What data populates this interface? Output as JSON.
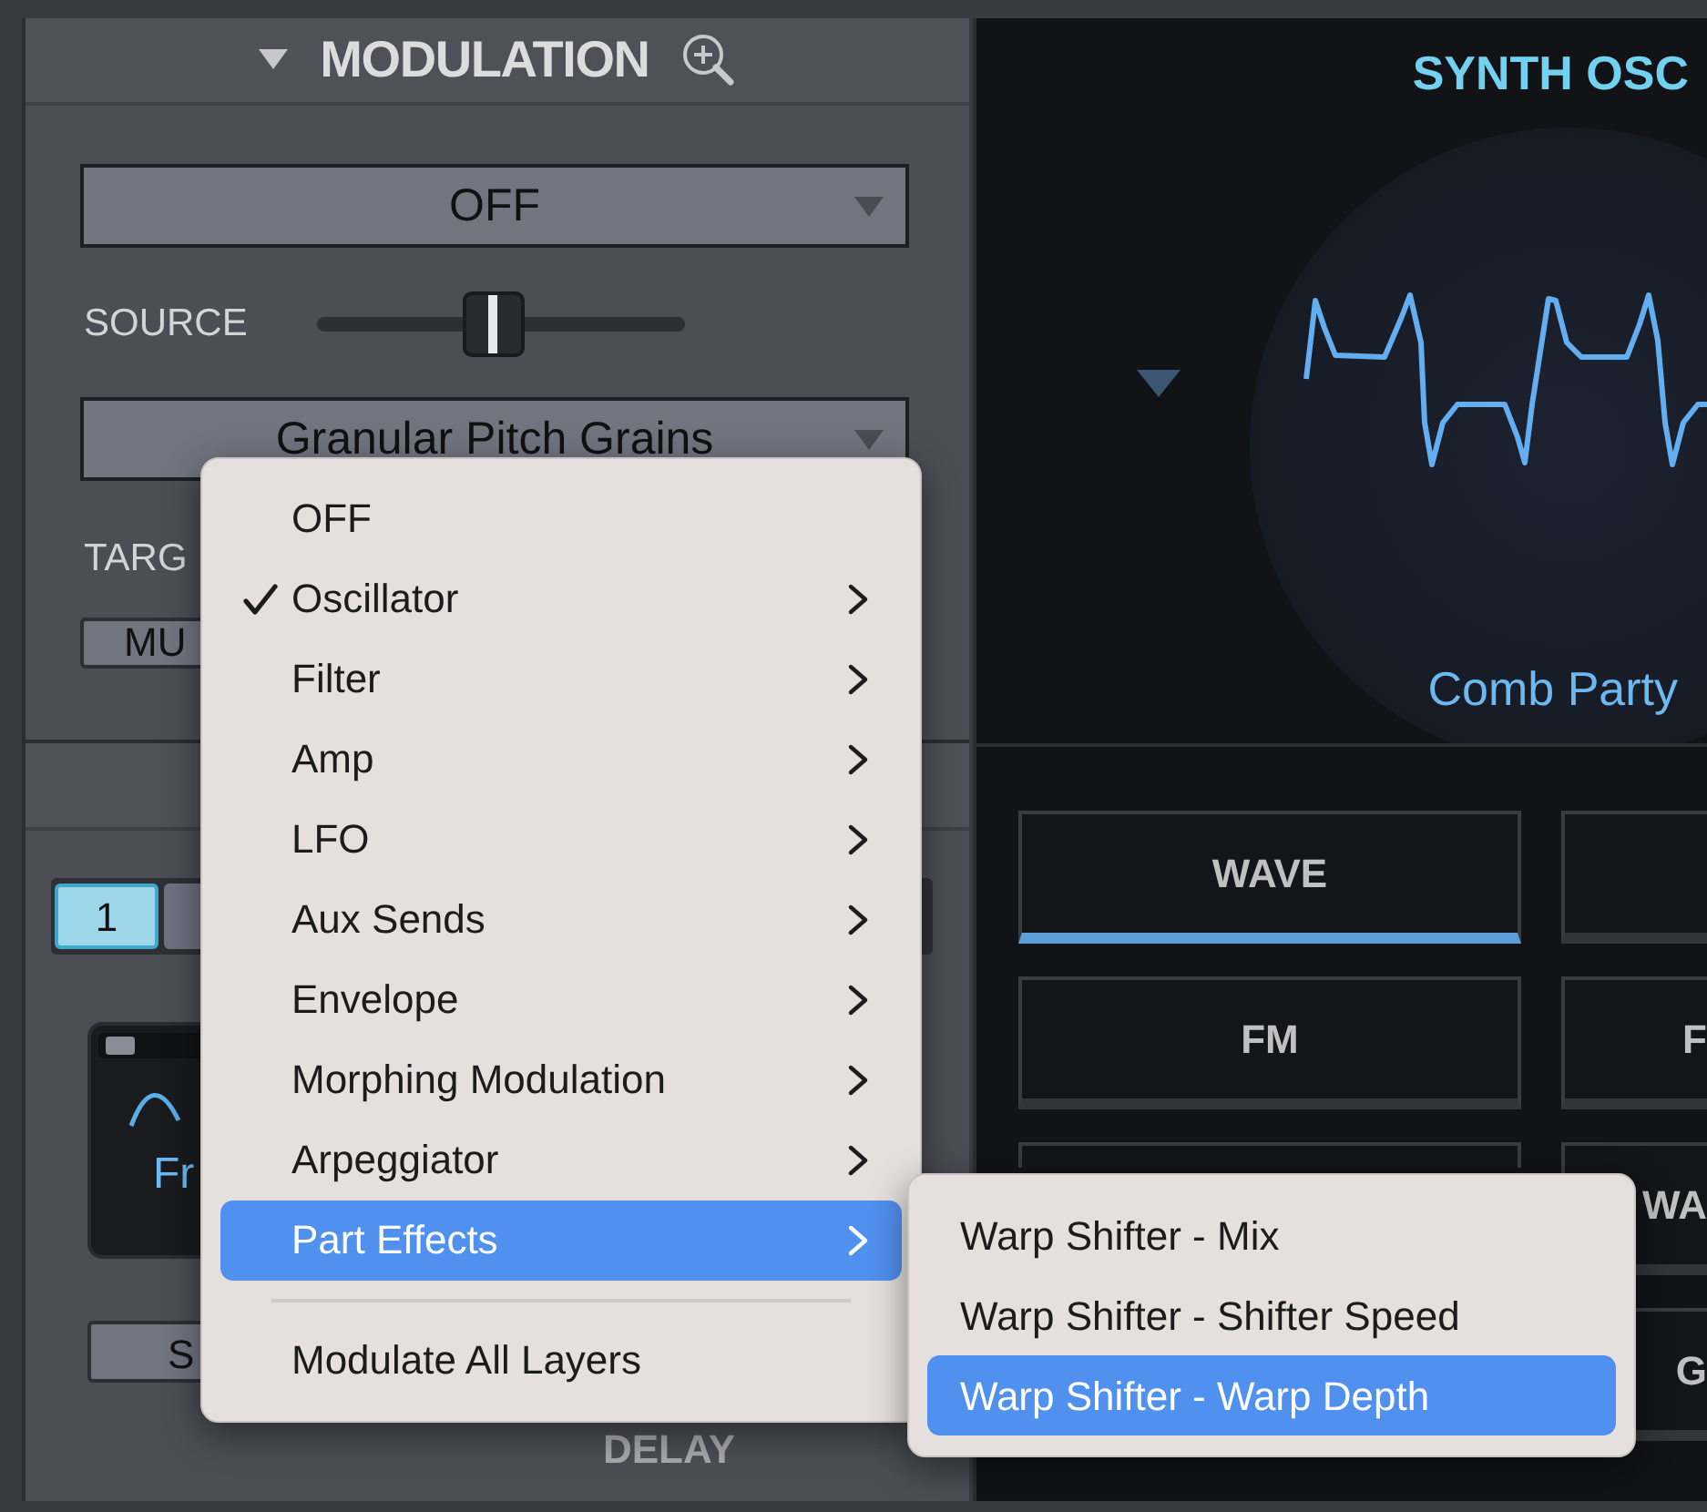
{
  "modulation_panel": {
    "title": "MODULATION",
    "source_dropdown": {
      "value": "OFF"
    },
    "source_label": "SOURCE",
    "source_slider": {
      "level": 0.48
    },
    "target_dropdown": {
      "value": "Granular Pitch Grains"
    },
    "target_label": "TARG",
    "mute_button": "MU"
  },
  "lower_panel": {
    "layer_buttons": [
      {
        "label": "1",
        "selected": true
      }
    ],
    "envelope_card": {
      "label": "Fr"
    },
    "s_button": "S",
    "delay_label": "DELAY"
  },
  "synth_osc": {
    "title": "SYNTH OSC",
    "preset": "Comb Party",
    "mode_buttons": [
      {
        "label": "WAVE",
        "selected": true
      },
      {
        "selected": false
      },
      {
        "label": "FM",
        "selected": false
      },
      {
        "label": "F",
        "selected": false
      },
      {
        "label": "WA",
        "selected": false
      },
      {
        "label": "G",
        "selected": false
      }
    ]
  },
  "menu": {
    "items": [
      {
        "kind": "item",
        "label": "OFF",
        "checked": false,
        "submenu": false,
        "selected": false
      },
      {
        "kind": "item",
        "label": "Oscillator",
        "checked": true,
        "submenu": true,
        "selected": false
      },
      {
        "kind": "item",
        "label": "Filter",
        "checked": false,
        "submenu": true,
        "selected": false
      },
      {
        "kind": "item",
        "label": "Amp",
        "checked": false,
        "submenu": true,
        "selected": false
      },
      {
        "kind": "item",
        "label": "LFO",
        "checked": false,
        "submenu": true,
        "selected": false
      },
      {
        "kind": "item",
        "label": "Aux Sends",
        "checked": false,
        "submenu": true,
        "selected": false
      },
      {
        "kind": "item",
        "label": "Envelope",
        "checked": false,
        "submenu": true,
        "selected": false
      },
      {
        "kind": "item",
        "label": "Morphing Modulation",
        "checked": false,
        "submenu": true,
        "selected": false
      },
      {
        "kind": "item",
        "label": "Arpeggiator",
        "checked": false,
        "submenu": true,
        "selected": false
      },
      {
        "kind": "item",
        "label": "Part Effects",
        "checked": false,
        "submenu": true,
        "selected": true
      },
      {
        "kind": "separator"
      },
      {
        "kind": "item",
        "label": "Modulate All Layers",
        "checked": false,
        "submenu": false,
        "selected": false
      }
    ],
    "submenu": {
      "items": [
        {
          "label": "Warp Shifter - Mix",
          "selected": false
        },
        {
          "label": "Warp Shifter - Shifter Speed",
          "selected": false
        },
        {
          "label": "Warp Shifter - Warp Depth",
          "selected": true
        }
      ]
    }
  }
}
